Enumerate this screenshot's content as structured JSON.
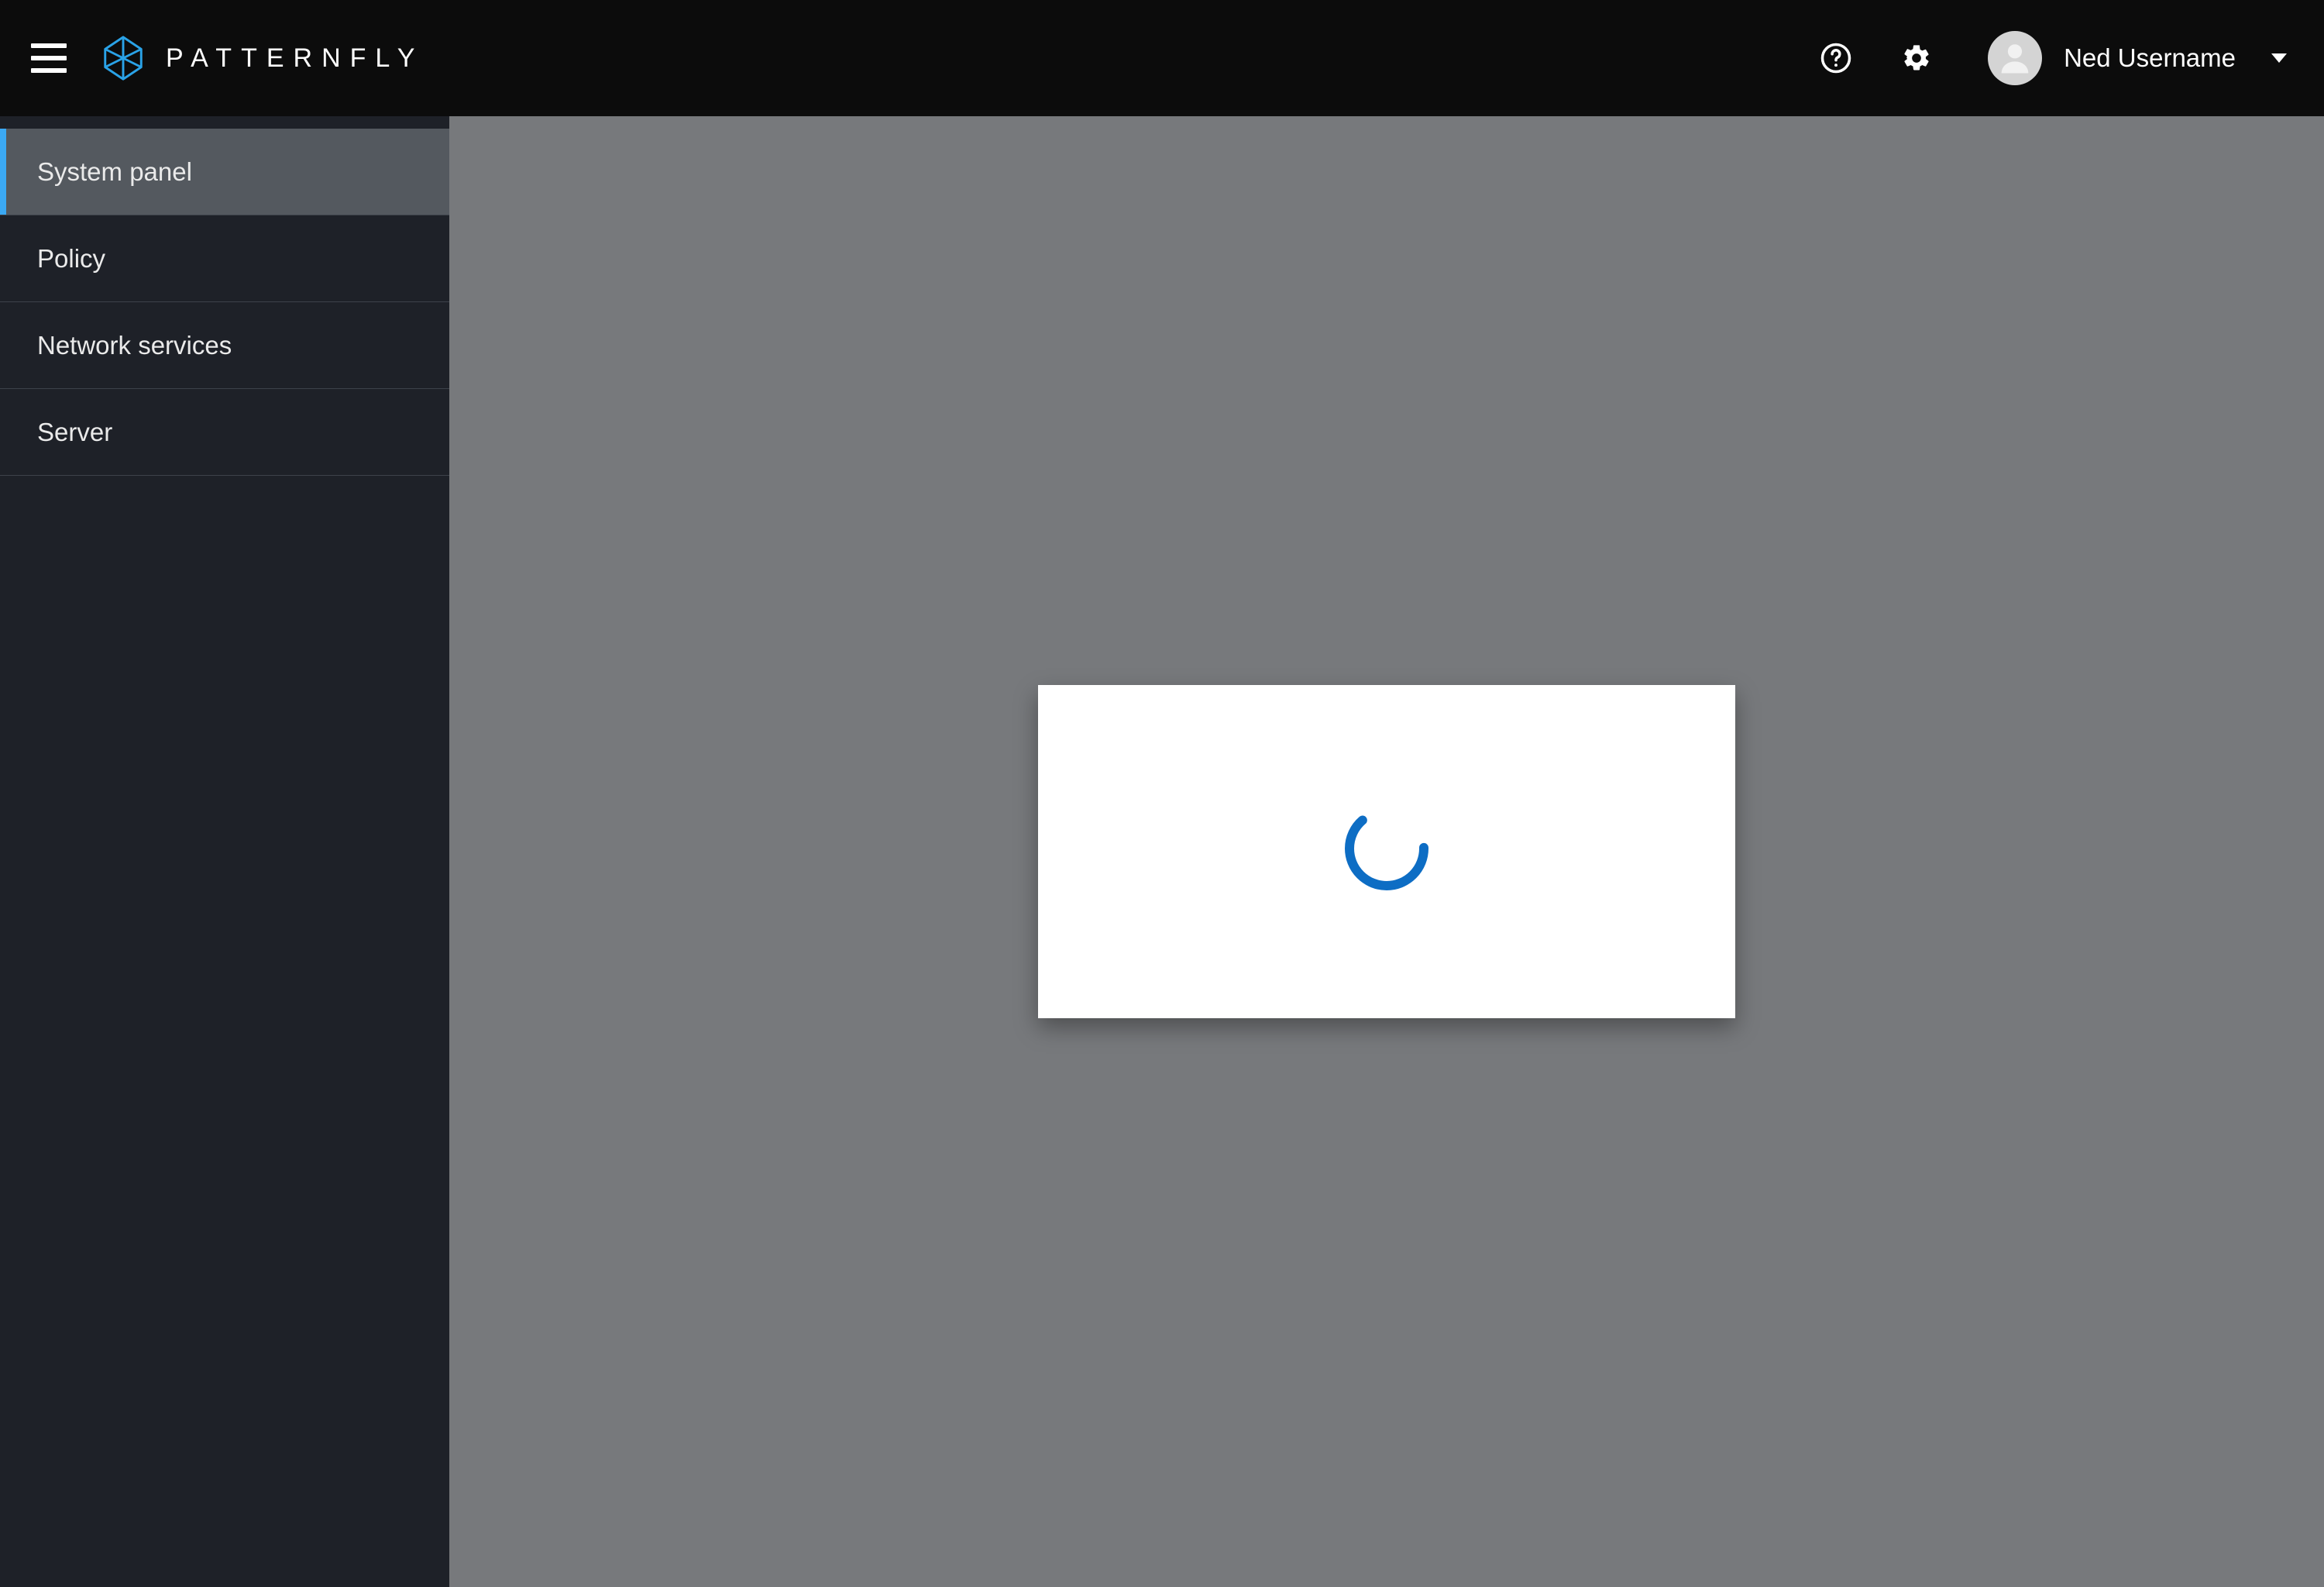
{
  "header": {
    "brand_text": "PATTERNFLY",
    "user_name": "Ned Username"
  },
  "sidebar": {
    "items": [
      {
        "label": "System panel",
        "active": true
      },
      {
        "label": "Policy",
        "active": false
      },
      {
        "label": "Network services",
        "active": false
      },
      {
        "label": "Server",
        "active": false
      }
    ]
  },
  "main": {
    "state": "loading"
  },
  "colors": {
    "accent": "#3ba9f4",
    "spinner": "#0d6dc4",
    "sidebar_bg": "#1e2128",
    "sidebar_active_bg": "#54595f",
    "content_bg": "#77797c"
  }
}
